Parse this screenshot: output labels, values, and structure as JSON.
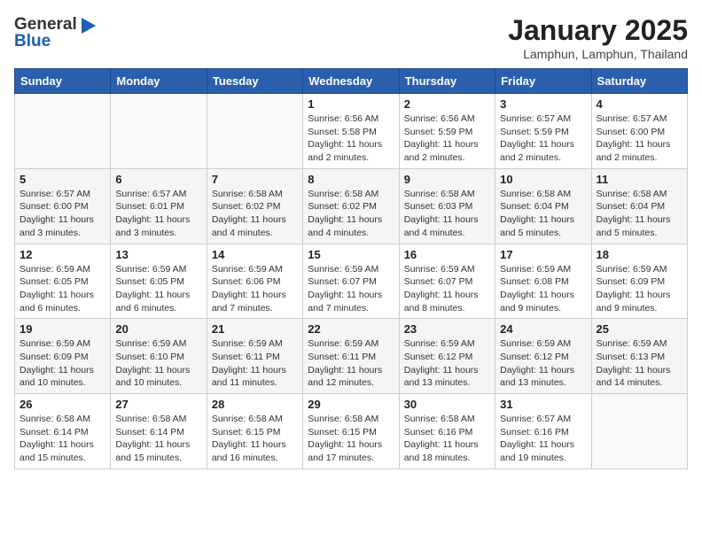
{
  "header": {
    "logo_general": "General",
    "logo_blue": "Blue",
    "month": "January 2025",
    "location": "Lamphun, Lamphun, Thailand"
  },
  "days_of_week": [
    "Sunday",
    "Monday",
    "Tuesday",
    "Wednesday",
    "Thursday",
    "Friday",
    "Saturday"
  ],
  "weeks": [
    [
      {
        "day": "",
        "sunrise": "",
        "sunset": "",
        "daylight": ""
      },
      {
        "day": "",
        "sunrise": "",
        "sunset": "",
        "daylight": ""
      },
      {
        "day": "",
        "sunrise": "",
        "sunset": "",
        "daylight": ""
      },
      {
        "day": "1",
        "sunrise": "Sunrise: 6:56 AM",
        "sunset": "Sunset: 5:58 PM",
        "daylight": "Daylight: 11 hours and 2 minutes."
      },
      {
        "day": "2",
        "sunrise": "Sunrise: 6:56 AM",
        "sunset": "Sunset: 5:59 PM",
        "daylight": "Daylight: 11 hours and 2 minutes."
      },
      {
        "day": "3",
        "sunrise": "Sunrise: 6:57 AM",
        "sunset": "Sunset: 5:59 PM",
        "daylight": "Daylight: 11 hours and 2 minutes."
      },
      {
        "day": "4",
        "sunrise": "Sunrise: 6:57 AM",
        "sunset": "Sunset: 6:00 PM",
        "daylight": "Daylight: 11 hours and 2 minutes."
      }
    ],
    [
      {
        "day": "5",
        "sunrise": "Sunrise: 6:57 AM",
        "sunset": "Sunset: 6:00 PM",
        "daylight": "Daylight: 11 hours and 3 minutes."
      },
      {
        "day": "6",
        "sunrise": "Sunrise: 6:57 AM",
        "sunset": "Sunset: 6:01 PM",
        "daylight": "Daylight: 11 hours and 3 minutes."
      },
      {
        "day": "7",
        "sunrise": "Sunrise: 6:58 AM",
        "sunset": "Sunset: 6:02 PM",
        "daylight": "Daylight: 11 hours and 4 minutes."
      },
      {
        "day": "8",
        "sunrise": "Sunrise: 6:58 AM",
        "sunset": "Sunset: 6:02 PM",
        "daylight": "Daylight: 11 hours and 4 minutes."
      },
      {
        "day": "9",
        "sunrise": "Sunrise: 6:58 AM",
        "sunset": "Sunset: 6:03 PM",
        "daylight": "Daylight: 11 hours and 4 minutes."
      },
      {
        "day": "10",
        "sunrise": "Sunrise: 6:58 AM",
        "sunset": "Sunset: 6:04 PM",
        "daylight": "Daylight: 11 hours and 5 minutes."
      },
      {
        "day": "11",
        "sunrise": "Sunrise: 6:58 AM",
        "sunset": "Sunset: 6:04 PM",
        "daylight": "Daylight: 11 hours and 5 minutes."
      }
    ],
    [
      {
        "day": "12",
        "sunrise": "Sunrise: 6:59 AM",
        "sunset": "Sunset: 6:05 PM",
        "daylight": "Daylight: 11 hours and 6 minutes."
      },
      {
        "day": "13",
        "sunrise": "Sunrise: 6:59 AM",
        "sunset": "Sunset: 6:05 PM",
        "daylight": "Daylight: 11 hours and 6 minutes."
      },
      {
        "day": "14",
        "sunrise": "Sunrise: 6:59 AM",
        "sunset": "Sunset: 6:06 PM",
        "daylight": "Daylight: 11 hours and 7 minutes."
      },
      {
        "day": "15",
        "sunrise": "Sunrise: 6:59 AM",
        "sunset": "Sunset: 6:07 PM",
        "daylight": "Daylight: 11 hours and 7 minutes."
      },
      {
        "day": "16",
        "sunrise": "Sunrise: 6:59 AM",
        "sunset": "Sunset: 6:07 PM",
        "daylight": "Daylight: 11 hours and 8 minutes."
      },
      {
        "day": "17",
        "sunrise": "Sunrise: 6:59 AM",
        "sunset": "Sunset: 6:08 PM",
        "daylight": "Daylight: 11 hours and 9 minutes."
      },
      {
        "day": "18",
        "sunrise": "Sunrise: 6:59 AM",
        "sunset": "Sunset: 6:09 PM",
        "daylight": "Daylight: 11 hours and 9 minutes."
      }
    ],
    [
      {
        "day": "19",
        "sunrise": "Sunrise: 6:59 AM",
        "sunset": "Sunset: 6:09 PM",
        "daylight": "Daylight: 11 hours and 10 minutes."
      },
      {
        "day": "20",
        "sunrise": "Sunrise: 6:59 AM",
        "sunset": "Sunset: 6:10 PM",
        "daylight": "Daylight: 11 hours and 10 minutes."
      },
      {
        "day": "21",
        "sunrise": "Sunrise: 6:59 AM",
        "sunset": "Sunset: 6:11 PM",
        "daylight": "Daylight: 11 hours and 11 minutes."
      },
      {
        "day": "22",
        "sunrise": "Sunrise: 6:59 AM",
        "sunset": "Sunset: 6:11 PM",
        "daylight": "Daylight: 11 hours and 12 minutes."
      },
      {
        "day": "23",
        "sunrise": "Sunrise: 6:59 AM",
        "sunset": "Sunset: 6:12 PM",
        "daylight": "Daylight: 11 hours and 13 minutes."
      },
      {
        "day": "24",
        "sunrise": "Sunrise: 6:59 AM",
        "sunset": "Sunset: 6:12 PM",
        "daylight": "Daylight: 11 hours and 13 minutes."
      },
      {
        "day": "25",
        "sunrise": "Sunrise: 6:59 AM",
        "sunset": "Sunset: 6:13 PM",
        "daylight": "Daylight: 11 hours and 14 minutes."
      }
    ],
    [
      {
        "day": "26",
        "sunrise": "Sunrise: 6:58 AM",
        "sunset": "Sunset: 6:14 PM",
        "daylight": "Daylight: 11 hours and 15 minutes."
      },
      {
        "day": "27",
        "sunrise": "Sunrise: 6:58 AM",
        "sunset": "Sunset: 6:14 PM",
        "daylight": "Daylight: 11 hours and 15 minutes."
      },
      {
        "day": "28",
        "sunrise": "Sunrise: 6:58 AM",
        "sunset": "Sunset: 6:15 PM",
        "daylight": "Daylight: 11 hours and 16 minutes."
      },
      {
        "day": "29",
        "sunrise": "Sunrise: 6:58 AM",
        "sunset": "Sunset: 6:15 PM",
        "daylight": "Daylight: 11 hours and 17 minutes."
      },
      {
        "day": "30",
        "sunrise": "Sunrise: 6:58 AM",
        "sunset": "Sunset: 6:16 PM",
        "daylight": "Daylight: 11 hours and 18 minutes."
      },
      {
        "day": "31",
        "sunrise": "Sunrise: 6:57 AM",
        "sunset": "Sunset: 6:16 PM",
        "daylight": "Daylight: 11 hours and 19 minutes."
      },
      {
        "day": "",
        "sunrise": "",
        "sunset": "",
        "daylight": ""
      }
    ]
  ]
}
